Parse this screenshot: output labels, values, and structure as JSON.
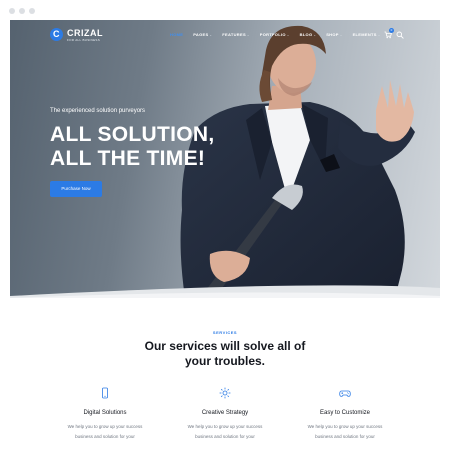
{
  "brand": {
    "name": "CRIZAL",
    "tagline": "FOR ALL BUSINESS",
    "mark": "C",
    "accent_color": "#2c7be5"
  },
  "nav": {
    "items": [
      {
        "label": "HOME",
        "caret": "",
        "active": true
      },
      {
        "label": "PAGES",
        "caret": "⌄",
        "active": false
      },
      {
        "label": "FEATURES",
        "caret": "⌄",
        "active": false
      },
      {
        "label": "PORTFOLIO",
        "caret": "⌄",
        "active": false
      },
      {
        "label": "BLOG",
        "caret": "⌄",
        "active": false
      },
      {
        "label": "SHOP",
        "caret": "⌄",
        "active": false
      },
      {
        "label": "ELEMENTS",
        "caret": "⌄",
        "active": false
      }
    ],
    "cart_count": "0",
    "icons": [
      "cart-icon",
      "search-icon"
    ]
  },
  "hero": {
    "tagline": "The experienced solution purveyors",
    "headline_line1": "ALL SOLUTION,",
    "headline_line2": "ALL THE TIME!",
    "cta_label": "Purchase Now"
  },
  "services": {
    "label": "SERVICES",
    "title_line1": "Our services will solve all of",
    "title_line2": "your troubles.",
    "items": [
      {
        "icon": "mobile-icon",
        "title": "Digital Solutions",
        "desc_line1": "We help you to grow up your success",
        "desc_line2": "business and solution for your"
      },
      {
        "icon": "sun-icon",
        "title": "Creative Strategy",
        "desc_line1": "We help you to grow up your success",
        "desc_line2": "business and solution for your"
      },
      {
        "icon": "gamepad-icon",
        "title": "Easy to Customize",
        "desc_line1": "We help you to grow up your success",
        "desc_line2": "business and solution for your"
      }
    ]
  }
}
